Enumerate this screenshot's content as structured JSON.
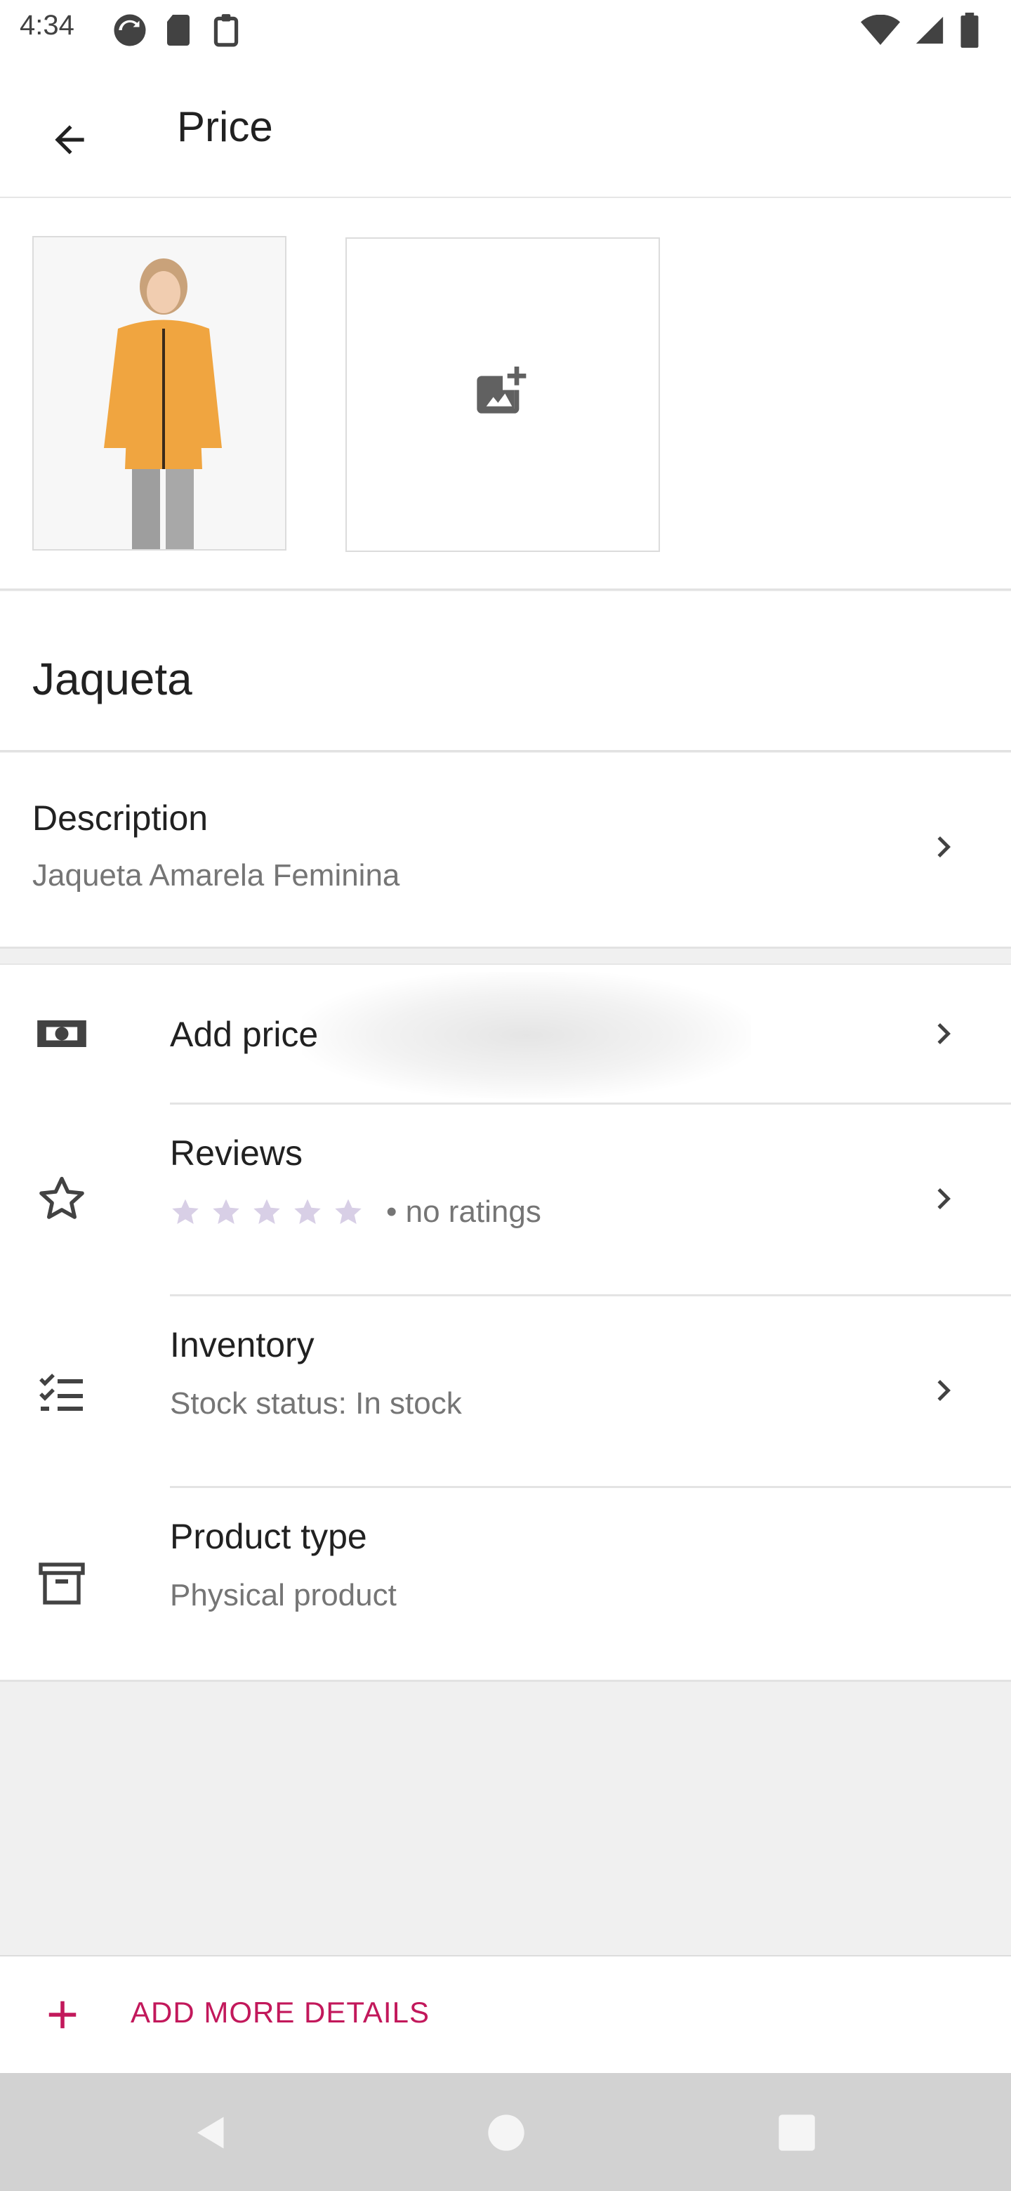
{
  "status_bar": {
    "time": "4:34"
  },
  "app_bar": {
    "title": "Price"
  },
  "images": {
    "product_image_alt": "Jaqueta product photo",
    "add_image_icon": "add-photo-icon"
  },
  "product": {
    "name": "Jaqueta"
  },
  "description": {
    "title": "Description",
    "value": "Jaqueta Amarela Feminina"
  },
  "settings": {
    "price": {
      "label": "Add price",
      "icon": "money-icon"
    },
    "reviews": {
      "label": "Reviews",
      "rating_text": "• no ratings",
      "stars": 0,
      "icon": "star-outline-icon"
    },
    "inventory": {
      "label": "Inventory",
      "value": "Stock status: In stock",
      "icon": "checklist-icon"
    },
    "product_type": {
      "label": "Product type",
      "value": "Physical product",
      "icon": "archive-icon"
    }
  },
  "footer": {
    "add_more_label": "ADD MORE DETAILS"
  },
  "colors": {
    "accent": "#c2185b",
    "star_empty": "#d8cfe6"
  }
}
